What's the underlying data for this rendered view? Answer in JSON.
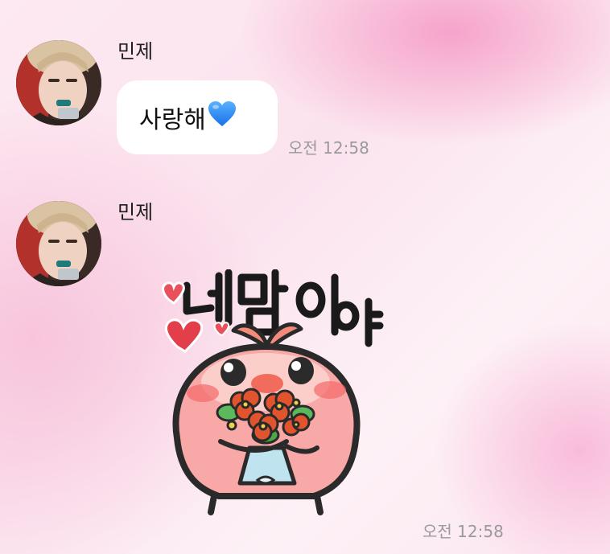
{
  "messages": [
    {
      "sender": "민제",
      "text": "사랑해",
      "emoji": "blue-heart",
      "time": "오전 12:58"
    },
    {
      "sender": "민제",
      "sticker_text": "내맘이야",
      "time": "오전 12:58"
    }
  ],
  "colors": {
    "bubble": "#ffffff",
    "time_text": "#9a9a9a",
    "sticker_body": "#f6a3a6",
    "blue_heart": "#2b8cff"
  }
}
